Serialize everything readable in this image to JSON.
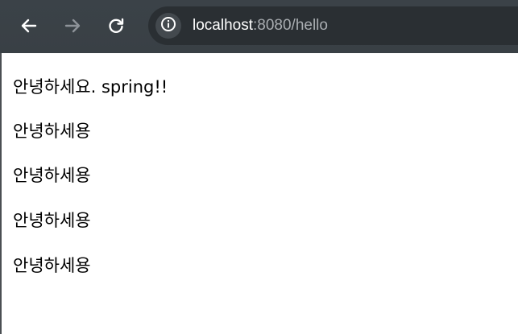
{
  "browser": {
    "url_host": "localhost",
    "url_rest": ":8080/hello",
    "icons": {
      "back": "arrow-left-icon",
      "forward": "arrow-right-icon",
      "reload": "reload-icon",
      "site_info": "info-icon"
    },
    "colors": {
      "toolbar": "#3b4248",
      "omnibox": "#2a2f33",
      "url_host": "#ffffff",
      "url_rest": "#a9adb1"
    }
  },
  "page": {
    "lines": [
      "안녕하세요. spring!!",
      "안녕하세용",
      "안녕하세용",
      "안녕하세용",
      "안녕하세용"
    ]
  }
}
